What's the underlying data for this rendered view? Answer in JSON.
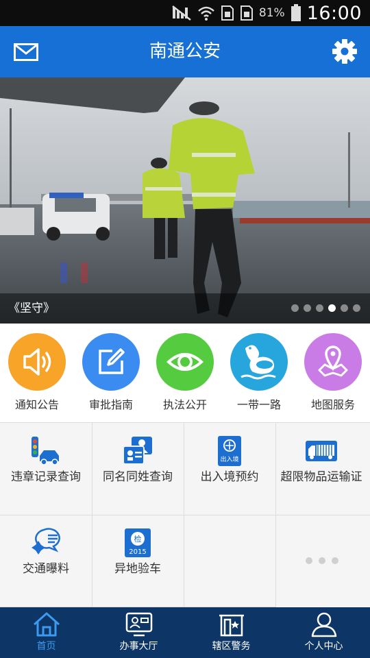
{
  "status_bar": {
    "battery": "81%",
    "time": "16:00"
  },
  "app_bar": {
    "title": "南通公安",
    "left_icon": "mail-icon",
    "right_icon": "gear-icon"
  },
  "banner": {
    "caption": "《坚守》",
    "page_count": 6,
    "active_page": 4
  },
  "quick_services": [
    {
      "label": "通知公告",
      "color": "#f7a428",
      "icon": "speaker-icon"
    },
    {
      "label": "审批指南",
      "color": "#3b8cf0",
      "icon": "edit-icon"
    },
    {
      "label": "执法公开",
      "color": "#55cc3f",
      "icon": "eye-icon"
    },
    {
      "label": "一带一路",
      "color": "#27a5dd",
      "icon": "obor-logo-icon"
    },
    {
      "label": "地图服务",
      "color": "#c97be6",
      "icon": "map-pin-icon"
    }
  ],
  "services": [
    {
      "label": "违章记录查询",
      "icon": "traffic-car-icon"
    },
    {
      "label": "同名同姓查询",
      "icon": "id-card-icon"
    },
    {
      "label": "出入境预约",
      "icon": "passport-icon"
    },
    {
      "label": "超限物品运输证",
      "icon": "truck-icon"
    },
    {
      "label": "交通曝料",
      "icon": "badge-chat-icon"
    },
    {
      "label": "异地验车",
      "icon": "inspection-2015-icon"
    }
  ],
  "service_badges": {
    "passport": "出入境",
    "inspection_top": "检",
    "inspection_year": "2015"
  },
  "tabs": [
    {
      "label": "首页",
      "icon": "home-icon",
      "active": true
    },
    {
      "label": "办事大厅",
      "icon": "service-hall-icon",
      "active": false
    },
    {
      "label": "辖区警务",
      "icon": "police-station-icon",
      "active": false
    },
    {
      "label": "个人中心",
      "icon": "user-icon",
      "active": false
    }
  ],
  "colors": {
    "primary": "#1670d6",
    "tab_bar": "#0d3566",
    "tab_active": "#3c9bf0"
  }
}
